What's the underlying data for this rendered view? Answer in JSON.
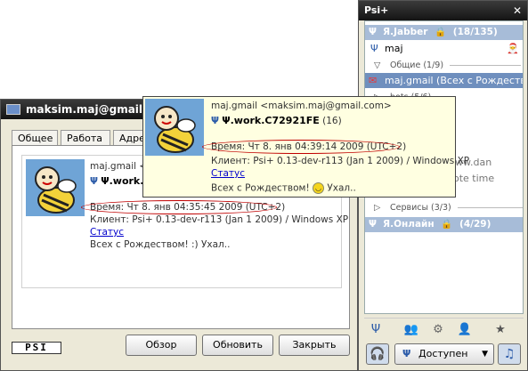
{
  "dialog": {
    "title": "maksim.maj@gmail.com",
    "tabs": [
      "Общее",
      "Работа",
      "Адрес"
    ],
    "jid_line": "maj.gmail <maksim.maj@gmail.com>",
    "resource": "Ψ.work.C72921FE",
    "time": "Время: Чт 8. янв 04:35:45 2009 (UTC+2)",
    "client": "Клиент: Psi+ 0.13-dev-r113 (Jan  1 2009) / Windows XP",
    "status_link": "Статус",
    "status_msg": "Всех с Рождеством! :) Ухал..",
    "logo": "PSI",
    "buttons": {
      "browse": "Обзор",
      "refresh": "Обновить",
      "close": "Закрыть"
    }
  },
  "tooltip": {
    "jid_line": "maj.gmail <maksim.maj@gmail.com>",
    "resource": "Ψ.work.C72921FE",
    "priority": "(16)",
    "time": "Время: Чт 8. янв 04:39:14 2009 (UTC+2)",
    "client": "Клиент: Psi+ 0.13-dev-r113 (Jan  1 2009) / Windows XP",
    "status_link": "Статус",
    "status_msg": "Всех с Рождеством!",
    "status_tail": "Ухал.."
  },
  "roster": {
    "title": "Psi+",
    "account1": {
      "name": "Я.Jabber",
      "count": "(18/135)"
    },
    "self_contact": "maj",
    "group_general": "Общие",
    "group_general_count": "(1/9)",
    "contact_gmail": "maj.gmail (Всех с Рождеством! :) Ухал..",
    "group_bots": "bots",
    "group_bots_count": "(5/6)",
    "partial_paren": ")",
    "partial_url": "www.dan",
    "partial_note": "note time",
    "group_services": "Сервисы",
    "group_services_count": "(3/3)",
    "account2": {
      "name": "Я.Онлайн",
      "count": "(4/29)"
    },
    "status_label": "Доступен"
  },
  "colors": {
    "title_bar": "#141414",
    "group_bg": "#a7bcd8",
    "link": "#0000cc",
    "ellipse": "#c00000"
  }
}
